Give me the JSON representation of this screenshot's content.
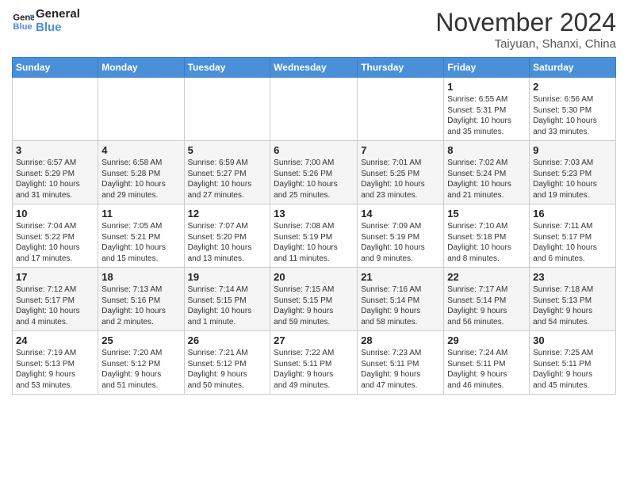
{
  "header": {
    "logo_line1": "General",
    "logo_line2": "Blue",
    "month": "November 2024",
    "location": "Taiyuan, Shanxi, China"
  },
  "weekdays": [
    "Sunday",
    "Monday",
    "Tuesday",
    "Wednesday",
    "Thursday",
    "Friday",
    "Saturday"
  ],
  "weeks": [
    [
      {
        "day": "",
        "info": ""
      },
      {
        "day": "",
        "info": ""
      },
      {
        "day": "",
        "info": ""
      },
      {
        "day": "",
        "info": ""
      },
      {
        "day": "",
        "info": ""
      },
      {
        "day": "1",
        "info": "Sunrise: 6:55 AM\nSunset: 5:31 PM\nDaylight: 10 hours\nand 35 minutes."
      },
      {
        "day": "2",
        "info": "Sunrise: 6:56 AM\nSunset: 5:30 PM\nDaylight: 10 hours\nand 33 minutes."
      }
    ],
    [
      {
        "day": "3",
        "info": "Sunrise: 6:57 AM\nSunset: 5:29 PM\nDaylight: 10 hours\nand 31 minutes."
      },
      {
        "day": "4",
        "info": "Sunrise: 6:58 AM\nSunset: 5:28 PM\nDaylight: 10 hours\nand 29 minutes."
      },
      {
        "day": "5",
        "info": "Sunrise: 6:59 AM\nSunset: 5:27 PM\nDaylight: 10 hours\nand 27 minutes."
      },
      {
        "day": "6",
        "info": "Sunrise: 7:00 AM\nSunset: 5:26 PM\nDaylight: 10 hours\nand 25 minutes."
      },
      {
        "day": "7",
        "info": "Sunrise: 7:01 AM\nSunset: 5:25 PM\nDaylight: 10 hours\nand 23 minutes."
      },
      {
        "day": "8",
        "info": "Sunrise: 7:02 AM\nSunset: 5:24 PM\nDaylight: 10 hours\nand 21 minutes."
      },
      {
        "day": "9",
        "info": "Sunrise: 7:03 AM\nSunset: 5:23 PM\nDaylight: 10 hours\nand 19 minutes."
      }
    ],
    [
      {
        "day": "10",
        "info": "Sunrise: 7:04 AM\nSunset: 5:22 PM\nDaylight: 10 hours\nand 17 minutes."
      },
      {
        "day": "11",
        "info": "Sunrise: 7:05 AM\nSunset: 5:21 PM\nDaylight: 10 hours\nand 15 minutes."
      },
      {
        "day": "12",
        "info": "Sunrise: 7:07 AM\nSunset: 5:20 PM\nDaylight: 10 hours\nand 13 minutes."
      },
      {
        "day": "13",
        "info": "Sunrise: 7:08 AM\nSunset: 5:19 PM\nDaylight: 10 hours\nand 11 minutes."
      },
      {
        "day": "14",
        "info": "Sunrise: 7:09 AM\nSunset: 5:19 PM\nDaylight: 10 hours\nand 9 minutes."
      },
      {
        "day": "15",
        "info": "Sunrise: 7:10 AM\nSunset: 5:18 PM\nDaylight: 10 hours\nand 8 minutes."
      },
      {
        "day": "16",
        "info": "Sunrise: 7:11 AM\nSunset: 5:17 PM\nDaylight: 10 hours\nand 6 minutes."
      }
    ],
    [
      {
        "day": "17",
        "info": "Sunrise: 7:12 AM\nSunset: 5:17 PM\nDaylight: 10 hours\nand 4 minutes."
      },
      {
        "day": "18",
        "info": "Sunrise: 7:13 AM\nSunset: 5:16 PM\nDaylight: 10 hours\nand 2 minutes."
      },
      {
        "day": "19",
        "info": "Sunrise: 7:14 AM\nSunset: 5:15 PM\nDaylight: 10 hours\nand 1 minute."
      },
      {
        "day": "20",
        "info": "Sunrise: 7:15 AM\nSunset: 5:15 PM\nDaylight: 9 hours\nand 59 minutes."
      },
      {
        "day": "21",
        "info": "Sunrise: 7:16 AM\nSunset: 5:14 PM\nDaylight: 9 hours\nand 58 minutes."
      },
      {
        "day": "22",
        "info": "Sunrise: 7:17 AM\nSunset: 5:14 PM\nDaylight: 9 hours\nand 56 minutes."
      },
      {
        "day": "23",
        "info": "Sunrise: 7:18 AM\nSunset: 5:13 PM\nDaylight: 9 hours\nand 54 minutes."
      }
    ],
    [
      {
        "day": "24",
        "info": "Sunrise: 7:19 AM\nSunset: 5:13 PM\nDaylight: 9 hours\nand 53 minutes."
      },
      {
        "day": "25",
        "info": "Sunrise: 7:20 AM\nSunset: 5:12 PM\nDaylight: 9 hours\nand 51 minutes."
      },
      {
        "day": "26",
        "info": "Sunrise: 7:21 AM\nSunset: 5:12 PM\nDaylight: 9 hours\nand 50 minutes."
      },
      {
        "day": "27",
        "info": "Sunrise: 7:22 AM\nSunset: 5:11 PM\nDaylight: 9 hours\nand 49 minutes."
      },
      {
        "day": "28",
        "info": "Sunrise: 7:23 AM\nSunset: 5:11 PM\nDaylight: 9 hours\nand 47 minutes."
      },
      {
        "day": "29",
        "info": "Sunrise: 7:24 AM\nSunset: 5:11 PM\nDaylight: 9 hours\nand 46 minutes."
      },
      {
        "day": "30",
        "info": "Sunrise: 7:25 AM\nSunset: 5:11 PM\nDaylight: 9 hours\nand 45 minutes."
      }
    ]
  ]
}
